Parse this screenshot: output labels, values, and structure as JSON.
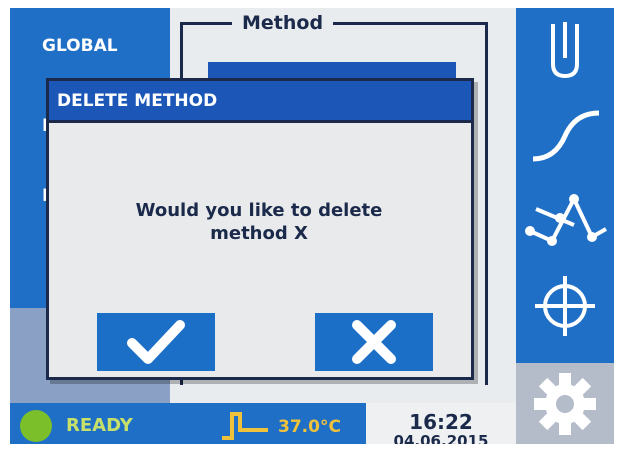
{
  "left_nav": {
    "items": [
      {
        "label": "GLOBAL"
      },
      {
        "label": "RU"
      },
      {
        "label": "PI"
      }
    ]
  },
  "method_panel": {
    "title": "Method"
  },
  "dialog": {
    "title": "DELETE METHOD",
    "message_line1": "Would you like to delete",
    "message_line2": "method X",
    "confirm_icon": "checkmark-icon",
    "cancel_icon": "x-icon"
  },
  "right_toolbar": {
    "tools": [
      {
        "icon": "test-tube-icon"
      },
      {
        "icon": "curve-icon"
      },
      {
        "icon": "graph-nodes-icon"
      },
      {
        "icon": "crosshair-icon"
      },
      {
        "icon": "gear-icon"
      }
    ]
  },
  "status_bar": {
    "status": "READY",
    "status_color": "#7bbf2a",
    "temperature": "37.0°C",
    "time": "16:22",
    "date": "04.06.2015"
  },
  "colors": {
    "primary_blue": "#1f6fc7",
    "dialog_header": "#1c57b8",
    "panel_bg": "#e9ecef",
    "temp_color": "#f0c13a"
  }
}
